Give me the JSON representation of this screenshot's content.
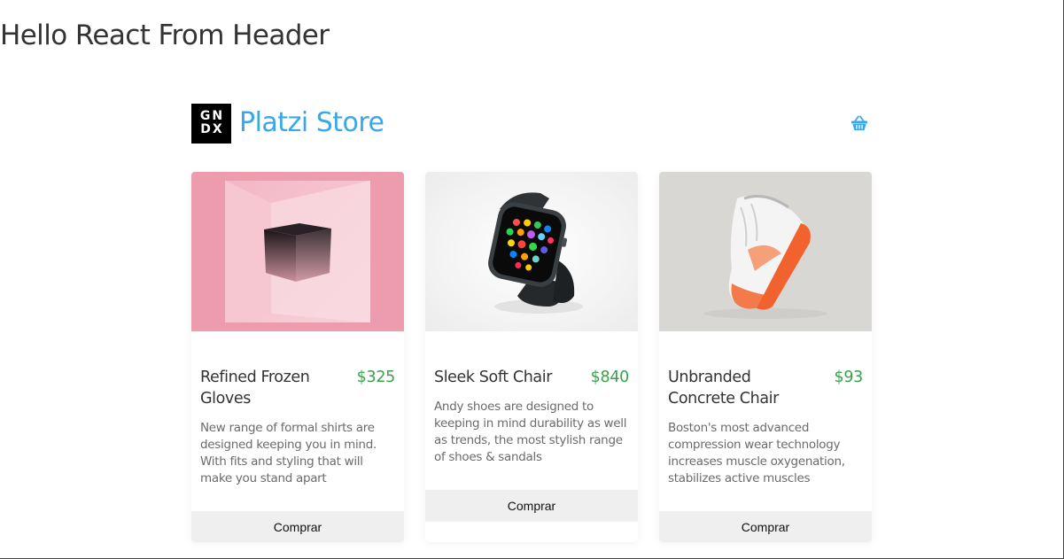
{
  "header": {
    "title": "Hello React From Header"
  },
  "store": {
    "logo": {
      "line1": "GN",
      "line2": "DX"
    },
    "title": "Platzi Store",
    "cart_icon": "basket-icon",
    "accent_color": "#39a8ea"
  },
  "products": [
    {
      "title": "Refined Frozen Gloves",
      "price": "$325",
      "description": "New range of formal shirts are designed keeping you in mind. With fits and styling that will make you stand apart",
      "buy_label": "Comprar",
      "image": "pink-cube-image"
    },
    {
      "title": "Sleek Soft Chair",
      "price": "$840",
      "description": "Andy shoes are designed to keeping in mind durability as well as trends, the most stylish range of shoes & sandals",
      "buy_label": "Comprar",
      "image": "smartwatch-image"
    },
    {
      "title": "Unbranded Concrete Chair",
      "price": "$93",
      "description": "Boston's most advanced compression wear technology increases muscle oxygenation, stabilizes active muscles",
      "buy_label": "Comprar",
      "image": "sneaker-image"
    }
  ],
  "colors": {
    "price": "#36a34a",
    "button_bg": "#efefef"
  }
}
